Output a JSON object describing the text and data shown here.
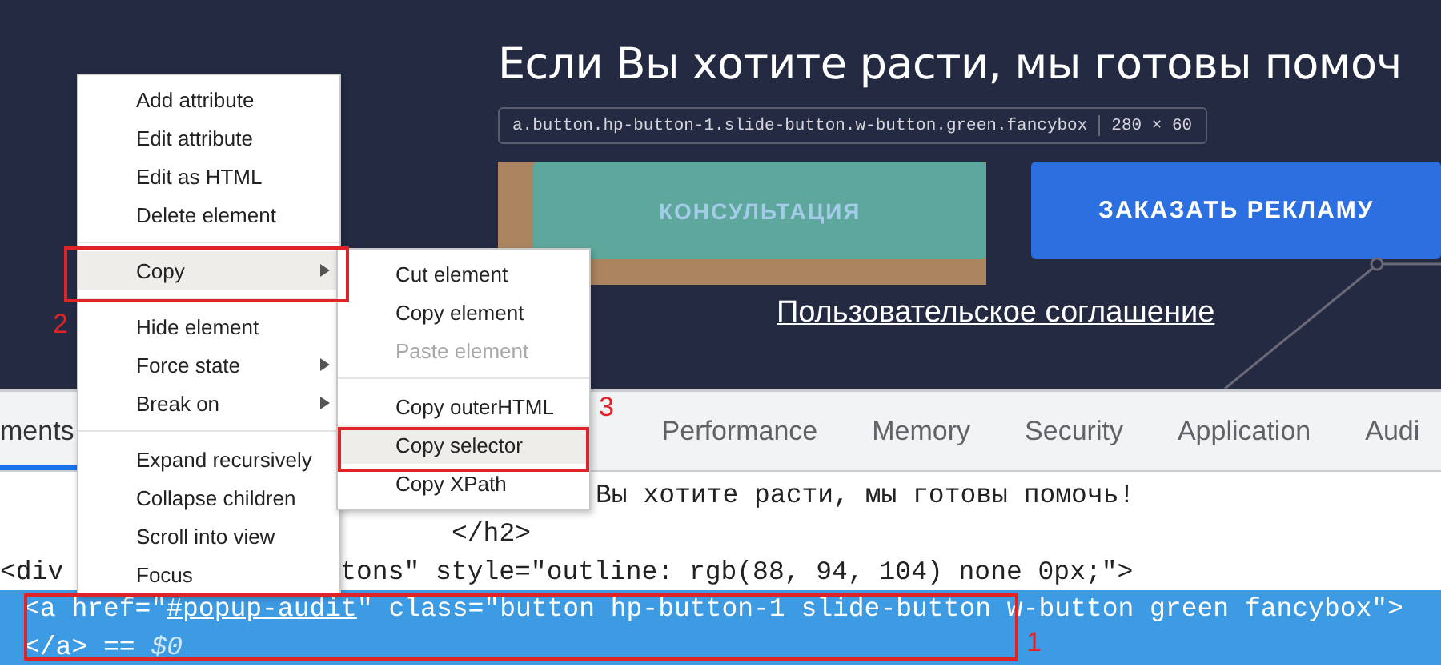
{
  "page": {
    "heading": "Если Вы хотите расти, мы готовы помоч",
    "element_tooltip": {
      "selector": "a.button.hp-button-1.slide-button.w-button.green.fancybox",
      "size": "280 × 60"
    },
    "buttons": [
      {
        "label": "КОНСУЛЬТАЦИЯ",
        "kind": "inspected"
      },
      {
        "label": "ЗАКАЗАТЬ РЕКЛАМУ",
        "kind": "primary"
      }
    ],
    "link": "Пользовательское соглашение"
  },
  "devtools": {
    "tabs": [
      {
        "label": "ments",
        "selected": true
      },
      {
        "label": "Performance",
        "selected": false
      },
      {
        "label": "Memory",
        "selected": false
      },
      {
        "label": "Security",
        "selected": false
      },
      {
        "label": "Application",
        "selected": false
      },
      {
        "label": "Audi",
        "selected": false
      }
    ],
    "code_lines": [
      {
        "selected": false,
        "fragments": [
          {
            "parts": [
              {
                "kind": "plain",
                "text": "Вы хотите расти, мы готовы помочь!"
              }
            ]
          }
        ]
      },
      {
        "selected": false,
        "fragments": [
          {
            "parts": [
              {
                "kind": "plain",
                "text": "</h2>"
              }
            ]
          }
        ]
      },
      {
        "selected": false,
        "fragments": [
          {
            "parts": [
              {
                "kind": "plain",
                "text": "<div"
              }
            ]
          },
          {
            "parts": [
              {
                "kind": "plain",
                "text": "tons\" style=\"outline: rgb(88, 94, 104) none 0px;\">"
              }
            ]
          }
        ]
      },
      {
        "selected": true,
        "fragments": [
          {
            "parts": [
              {
                "kind": "plain",
                "text": "<a href=\""
              },
              {
                "kind": "link",
                "text": "#popup-audit"
              },
              {
                "kind": "plain",
                "text": "\" class=\"button hp-button-1 slide-button w-button green fancybox\">"
              }
            ]
          }
        ]
      },
      {
        "selected": true,
        "fragments": [
          {
            "parts": [
              {
                "kind": "plain",
                "text": "</a> == "
              },
              {
                "kind": "italic",
                "text": "$0"
              }
            ]
          }
        ]
      }
    ]
  },
  "context_menu": {
    "items": [
      {
        "kind": "item",
        "label": "Add attribute",
        "has_submenu": false,
        "highlighted": false
      },
      {
        "kind": "item",
        "label": "Edit attribute",
        "has_submenu": false,
        "highlighted": false
      },
      {
        "kind": "item",
        "label": "Edit as HTML",
        "has_submenu": false,
        "highlighted": false
      },
      {
        "kind": "item",
        "label": "Delete element",
        "has_submenu": false,
        "highlighted": false
      },
      {
        "kind": "separator"
      },
      {
        "kind": "item",
        "label": "Copy",
        "has_submenu": true,
        "highlighted": true
      },
      {
        "kind": "separator"
      },
      {
        "kind": "item",
        "label": "Hide element",
        "has_submenu": false,
        "highlighted": false
      },
      {
        "kind": "item",
        "label": "Force state",
        "has_submenu": true,
        "highlighted": false
      },
      {
        "kind": "item",
        "label": "Break on",
        "has_submenu": true,
        "highlighted": false
      },
      {
        "kind": "separator"
      },
      {
        "kind": "item",
        "label": "Expand recursively",
        "has_submenu": false,
        "highlighted": false
      },
      {
        "kind": "item",
        "label": "Collapse children",
        "has_submenu": false,
        "highlighted": false
      },
      {
        "kind": "item",
        "label": "Scroll into view",
        "has_submenu": false,
        "highlighted": false
      },
      {
        "kind": "item",
        "label": "Focus",
        "has_submenu": false,
        "highlighted": false
      }
    ]
  },
  "submenu": {
    "items": [
      {
        "kind": "item",
        "label": "Cut element",
        "highlighted": false,
        "disabled": false
      },
      {
        "kind": "item",
        "label": "Copy element",
        "highlighted": false,
        "disabled": false
      },
      {
        "kind": "item",
        "label": "Paste element",
        "highlighted": false,
        "disabled": true
      },
      {
        "kind": "separator"
      },
      {
        "kind": "item",
        "label": "Copy outerHTML",
        "highlighted": false,
        "disabled": false
      },
      {
        "kind": "item",
        "label": "Copy selector",
        "highlighted": true,
        "disabled": false
      },
      {
        "kind": "item",
        "label": "Copy XPath",
        "highlighted": false,
        "disabled": false
      }
    ]
  },
  "annotations": [
    {
      "label": "2"
    },
    {
      "label": "3"
    },
    {
      "label": "1"
    }
  ]
}
